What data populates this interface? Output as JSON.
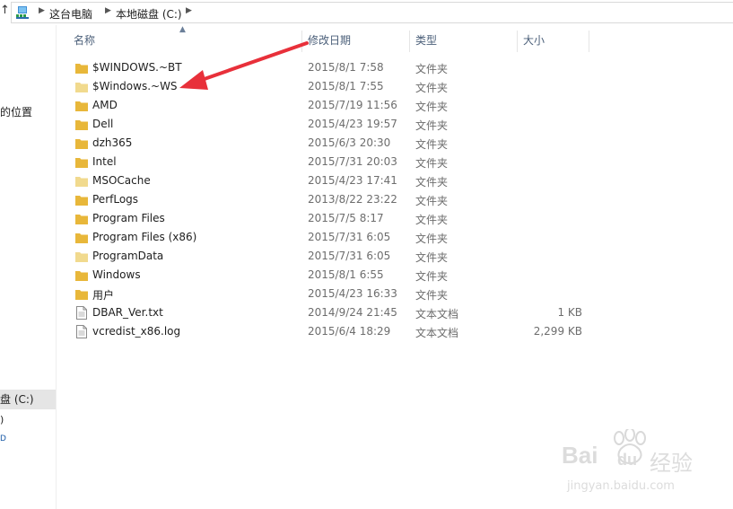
{
  "address": {
    "crumbs": [
      "这台电脑",
      "本地磁盘 (C:)"
    ]
  },
  "nav": {
    "recent_places": "的位置",
    "drive_label": "盘 (C:)",
    "frag1": ")",
    "frag2": "D"
  },
  "columns": {
    "name": "名称",
    "date": "修改日期",
    "type": "类型",
    "size": "大小"
  },
  "files": [
    {
      "name": "$WINDOWS.~BT",
      "date": "2015/8/1 7:58",
      "type": "文件夹",
      "size": "",
      "kind": "folder"
    },
    {
      "name": "$Windows.~WS",
      "date": "2015/8/1 7:55",
      "type": "文件夹",
      "size": "",
      "kind": "folder-hidden"
    },
    {
      "name": "AMD",
      "date": "2015/7/19 11:56",
      "type": "文件夹",
      "size": "",
      "kind": "folder"
    },
    {
      "name": "Dell",
      "date": "2015/4/23 19:57",
      "type": "文件夹",
      "size": "",
      "kind": "folder"
    },
    {
      "name": "dzh365",
      "date": "2015/6/3 20:30",
      "type": "文件夹",
      "size": "",
      "kind": "folder"
    },
    {
      "name": "Intel",
      "date": "2015/7/31 20:03",
      "type": "文件夹",
      "size": "",
      "kind": "folder"
    },
    {
      "name": "MSOCache",
      "date": "2015/4/23 17:41",
      "type": "文件夹",
      "size": "",
      "kind": "folder-hidden"
    },
    {
      "name": "PerfLogs",
      "date": "2013/8/22 23:22",
      "type": "文件夹",
      "size": "",
      "kind": "folder"
    },
    {
      "name": "Program Files",
      "date": "2015/7/5 8:17",
      "type": "文件夹",
      "size": "",
      "kind": "folder"
    },
    {
      "name": "Program Files (x86)",
      "date": "2015/7/31 6:05",
      "type": "文件夹",
      "size": "",
      "kind": "folder"
    },
    {
      "name": "ProgramData",
      "date": "2015/7/31 6:05",
      "type": "文件夹",
      "size": "",
      "kind": "folder-hidden"
    },
    {
      "name": "Windows",
      "date": "2015/8/1 6:55",
      "type": "文件夹",
      "size": "",
      "kind": "folder"
    },
    {
      "name": "用户",
      "date": "2015/4/23 16:33",
      "type": "文件夹",
      "size": "",
      "kind": "folder"
    },
    {
      "name": "DBAR_Ver.txt",
      "date": "2014/9/24 21:45",
      "type": "文本文档",
      "size": "1 KB",
      "kind": "file"
    },
    {
      "name": "vcredist_x86.log",
      "date": "2015/6/4 18:29",
      "type": "文本文档",
      "size": "2,299 KB",
      "kind": "file"
    }
  ],
  "watermark": {
    "brand": "Bai",
    "brand2": "du",
    "cn": "经验",
    "url": "jingyan.baidu.com"
  },
  "colors": {
    "folder": "#e8b73b",
    "folder_hidden": "#f1d98e",
    "arrow": "#e8303a",
    "header_text": "#4c607a"
  },
  "icons": {
    "up": "up-arrow-icon",
    "pc": "computer-icon",
    "folder": "folder-icon",
    "file": "text-file-icon"
  }
}
